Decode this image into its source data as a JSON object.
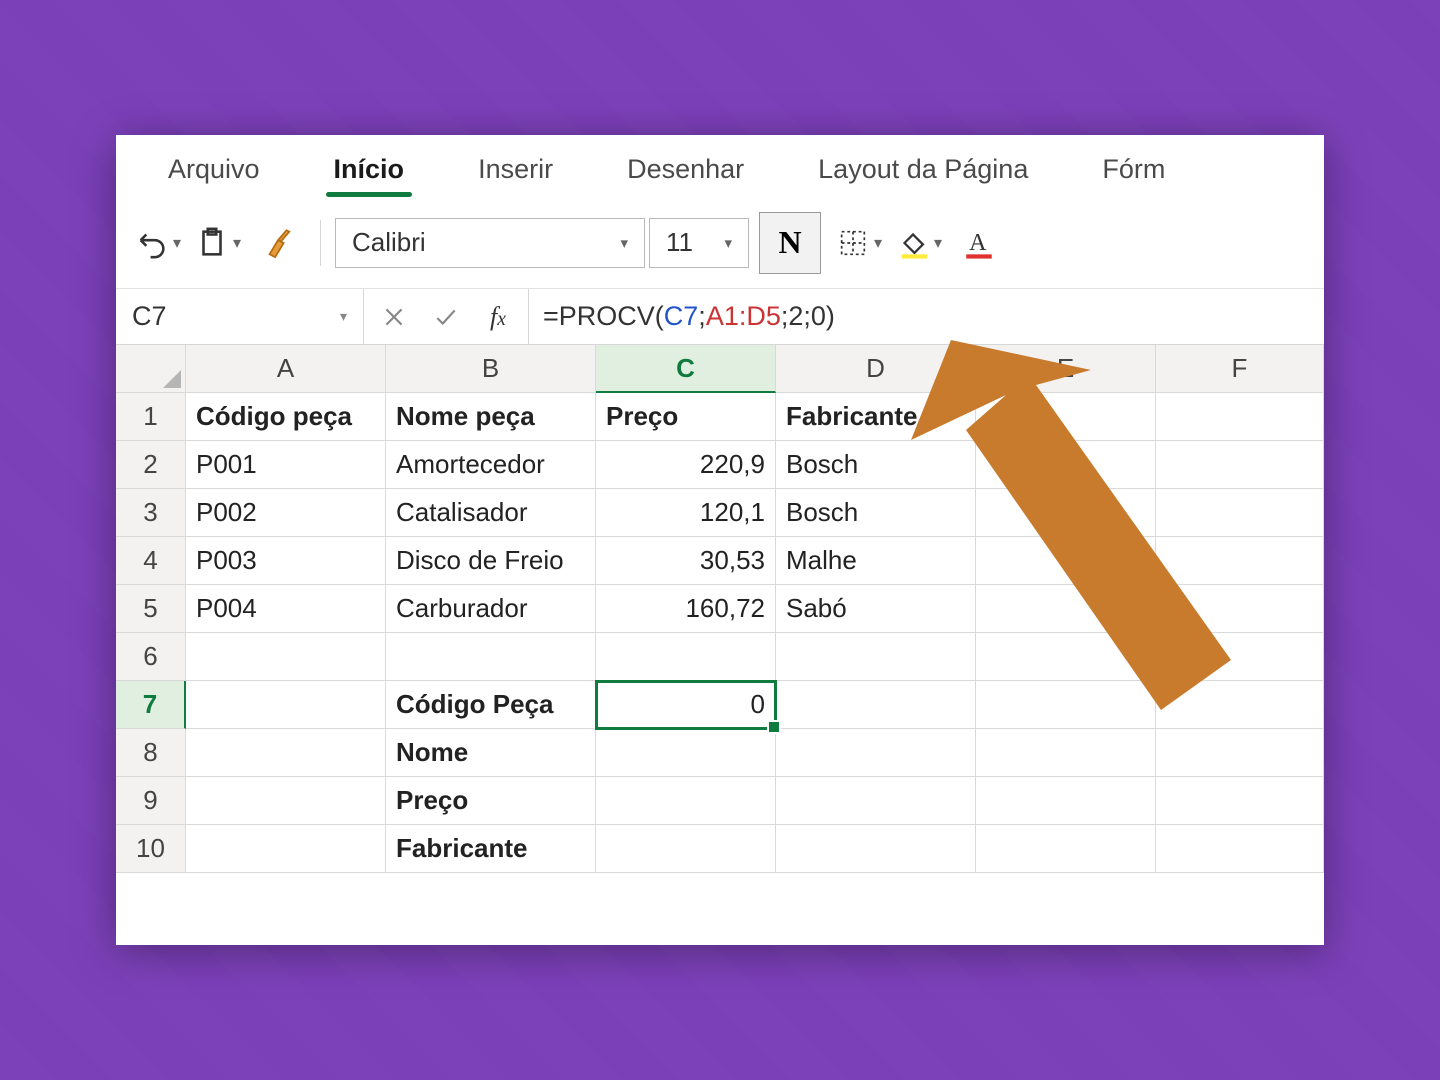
{
  "ribbon": {
    "tabs": [
      "Arquivo",
      "Início",
      "Inserir",
      "Desenhar",
      "Layout da Página",
      "Fórm"
    ],
    "active_index": 1
  },
  "toolbar": {
    "font_name": "Calibri",
    "font_size": "11",
    "bold_label": "N"
  },
  "formula_bar": {
    "name_box": "C7",
    "formula_prefix": "=PROCV(",
    "formula_ref1": "C7",
    "formula_sep1": ";",
    "formula_ref2": "A1:D5",
    "formula_suffix": ";2;0)"
  },
  "grid": {
    "columns": [
      "A",
      "B",
      "C",
      "D",
      "E",
      "F"
    ],
    "rows": [
      "1",
      "2",
      "3",
      "4",
      "5",
      "6",
      "7",
      "8",
      "9",
      "10"
    ],
    "active_col_index": 2,
    "active_row_index": 6,
    "cells": {
      "A1": "Código peça",
      "B1": "Nome peça",
      "C1": "Preço",
      "D1": "Fabricante",
      "A2": "P001",
      "B2": "Amortecedor",
      "C2": "220,9",
      "D2": "Bosch",
      "A3": "P002",
      "B3": "Catalisador",
      "C3": "120,1",
      "D3": "Bosch",
      "A4": "P003",
      "B4": "Disco de Freio",
      "C4": "30,53",
      "D4": "Malhe",
      "A5": "P004",
      "B5": "Carburador",
      "C5": "160,72",
      "D5": "Sabó",
      "B7": "Código Peça",
      "C7": "0",
      "B8": "Nome",
      "B9": "Preço",
      "B10": "Fabricante"
    }
  }
}
